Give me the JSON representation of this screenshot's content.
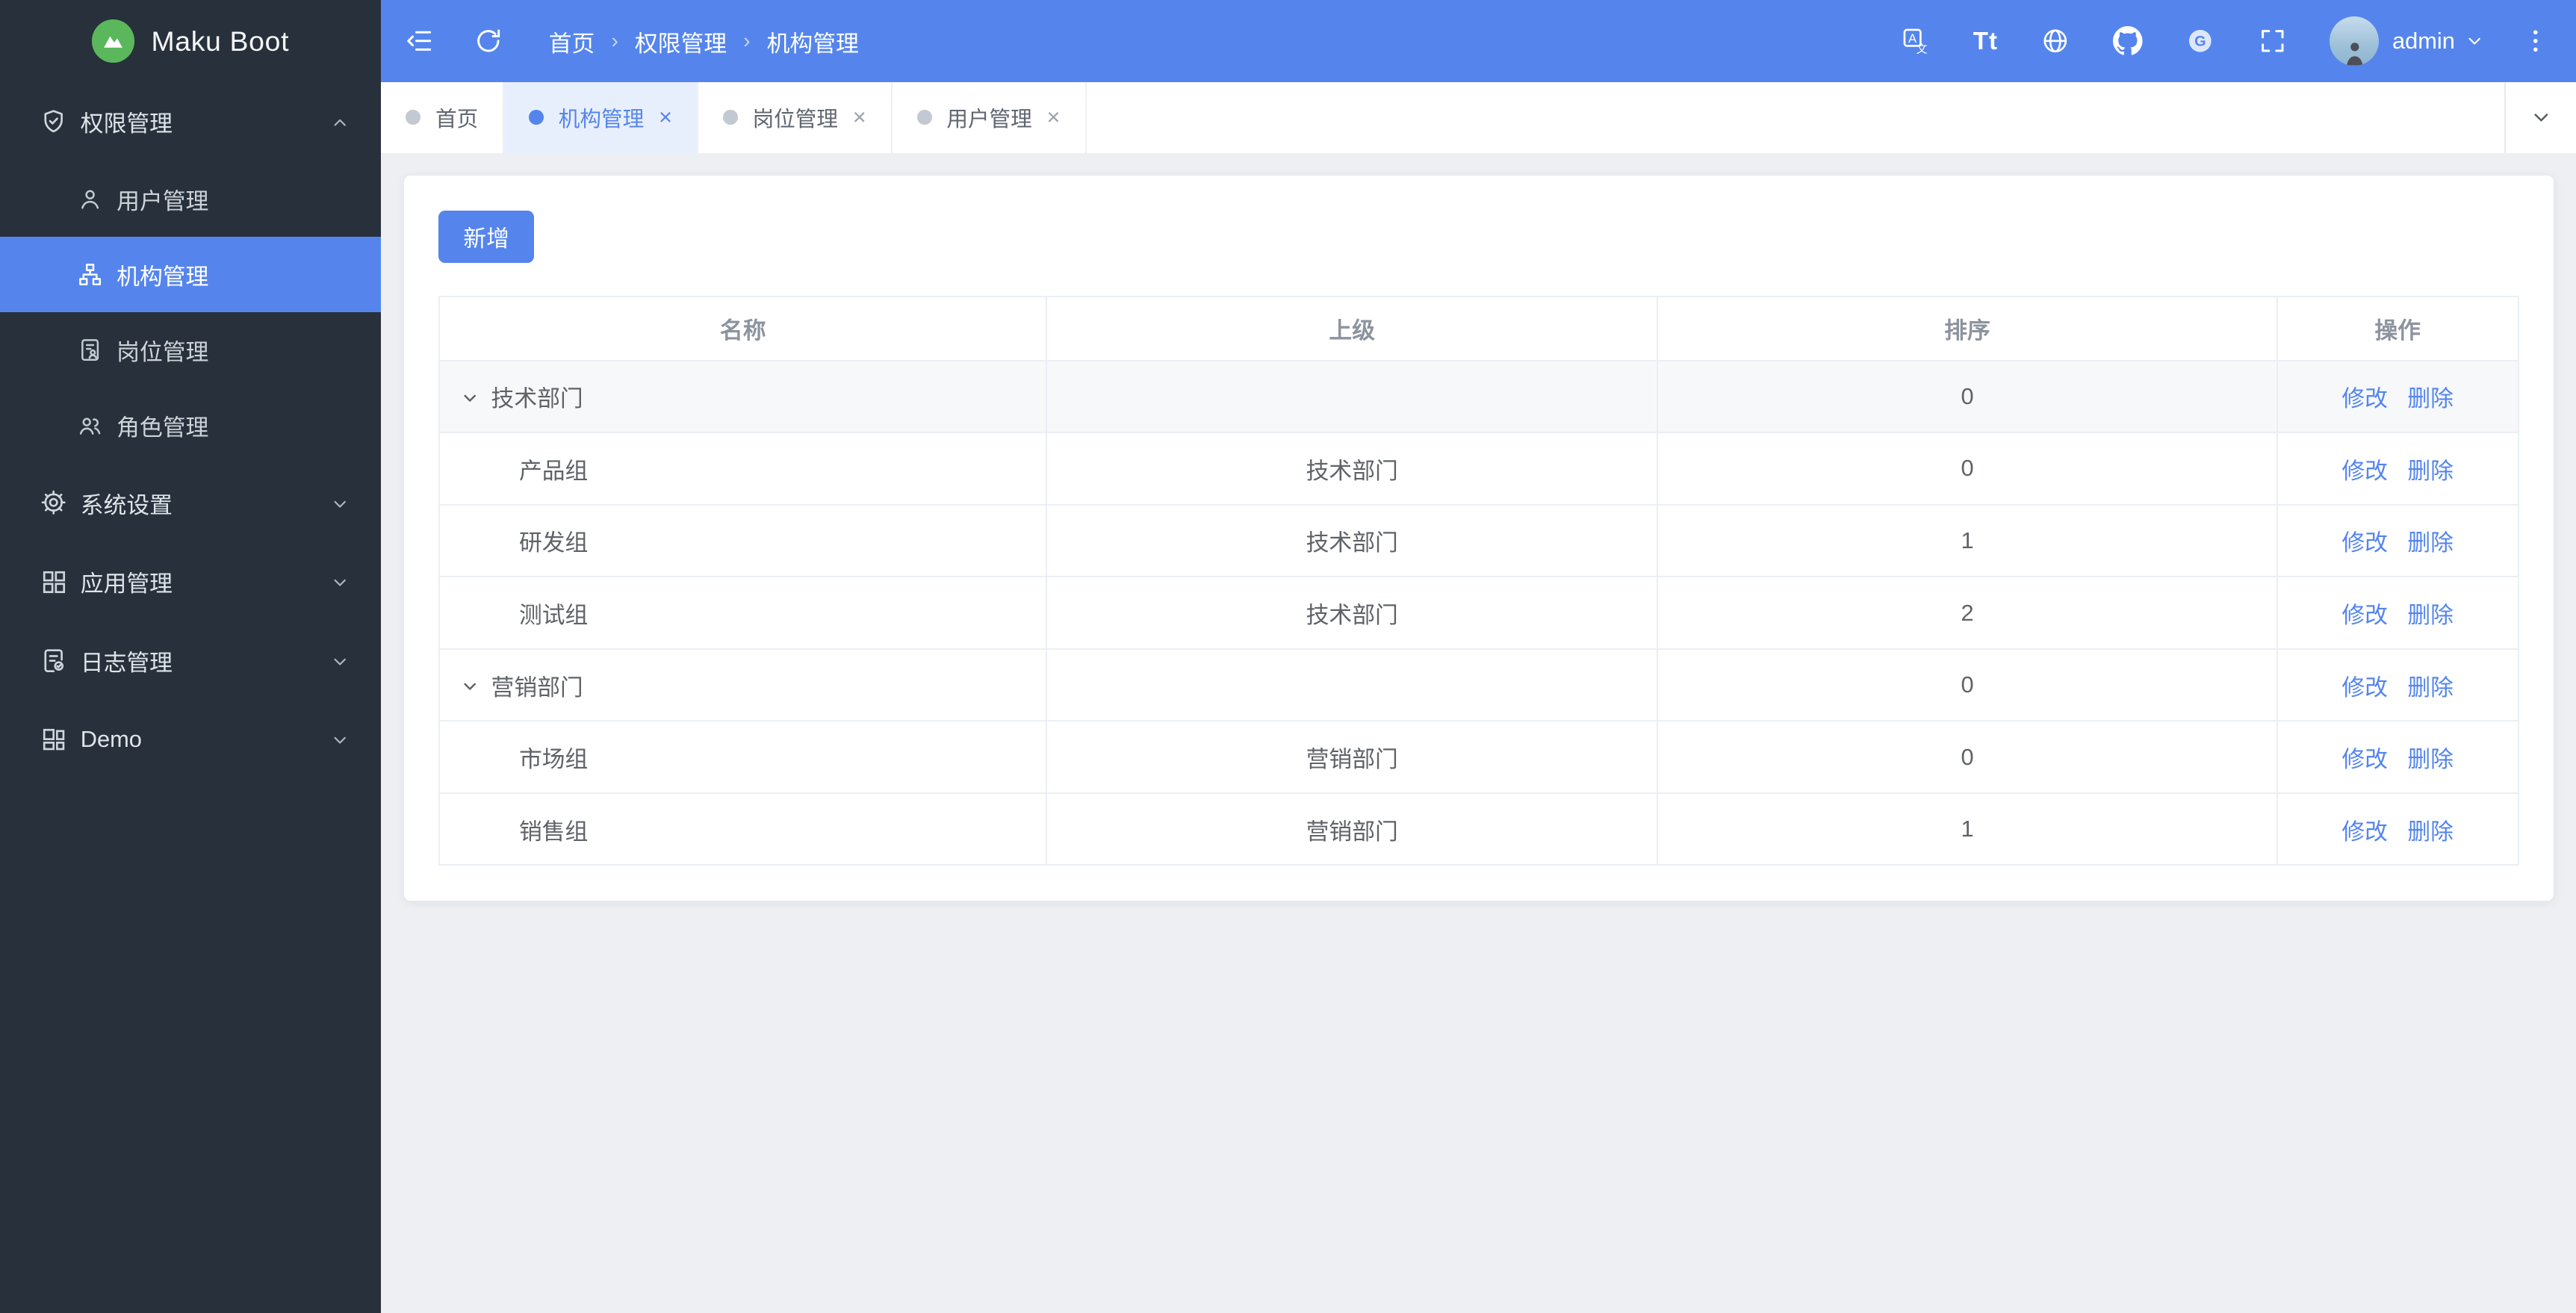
{
  "app": {
    "title": "Maku Boot"
  },
  "colors": {
    "accent": "#5585ec",
    "sidebar_bg": "#28313b",
    "header_bg": "#5585ec",
    "active_tab_bg": "#e8effc",
    "logo_green": "#5bb75b",
    "table_border": "#ebeef5"
  },
  "header": {
    "breadcrumb": [
      "首页",
      "权限管理",
      "机构管理"
    ],
    "separator": "›",
    "username": "admin",
    "icons": [
      "menu-fold",
      "refresh",
      "translate",
      "font-size",
      "globe",
      "github",
      "gitee",
      "fullscreen",
      "avatar",
      "caret-down",
      "kebab-menu"
    ]
  },
  "tabs": {
    "close_glyph": "×",
    "items": [
      {
        "label": "首页",
        "active": false,
        "closable": false
      },
      {
        "label": "机构管理",
        "active": true,
        "closable": true
      },
      {
        "label": "岗位管理",
        "active": false,
        "closable": true
      },
      {
        "label": "用户管理",
        "active": false,
        "closable": true
      }
    ]
  },
  "sidebar": {
    "items": [
      {
        "label": "权限管理",
        "type": "group",
        "icon": "shield-check",
        "expanded": true
      },
      {
        "label": "用户管理",
        "type": "child",
        "icon": "user",
        "active": false
      },
      {
        "label": "机构管理",
        "type": "child",
        "icon": "org-tree",
        "active": true
      },
      {
        "label": "岗位管理",
        "type": "child",
        "icon": "post-doc",
        "active": false
      },
      {
        "label": "角色管理",
        "type": "child",
        "icon": "roles",
        "active": false
      },
      {
        "label": "系统设置",
        "type": "group",
        "icon": "gear",
        "expanded": false
      },
      {
        "label": "应用管理",
        "type": "group",
        "icon": "app-grid",
        "expanded": false
      },
      {
        "label": "日志管理",
        "type": "group",
        "icon": "log-doc",
        "expanded": false
      },
      {
        "label": "Demo",
        "type": "group",
        "icon": "demo-grid",
        "expanded": false
      }
    ]
  },
  "main": {
    "add_button": "新增",
    "table": {
      "columns": [
        "名称",
        "上级",
        "排序",
        "操作"
      ],
      "edit_label": "修改",
      "delete_label": "删除",
      "rows": [
        {
          "name": "技术部门",
          "parent": "",
          "sort": "0",
          "level": 0,
          "expanded": true
        },
        {
          "name": "产品组",
          "parent": "技术部门",
          "sort": "0",
          "level": 1
        },
        {
          "name": "研发组",
          "parent": "技术部门",
          "sort": "1",
          "level": 1
        },
        {
          "name": "测试组",
          "parent": "技术部门",
          "sort": "2",
          "level": 1
        },
        {
          "name": "营销部门",
          "parent": "",
          "sort": "0",
          "level": 0,
          "expanded": true
        },
        {
          "name": "市场组",
          "parent": "营销部门",
          "sort": "0",
          "level": 1
        },
        {
          "name": "销售组",
          "parent": "营销部门",
          "sort": "1",
          "level": 1
        }
      ]
    }
  }
}
